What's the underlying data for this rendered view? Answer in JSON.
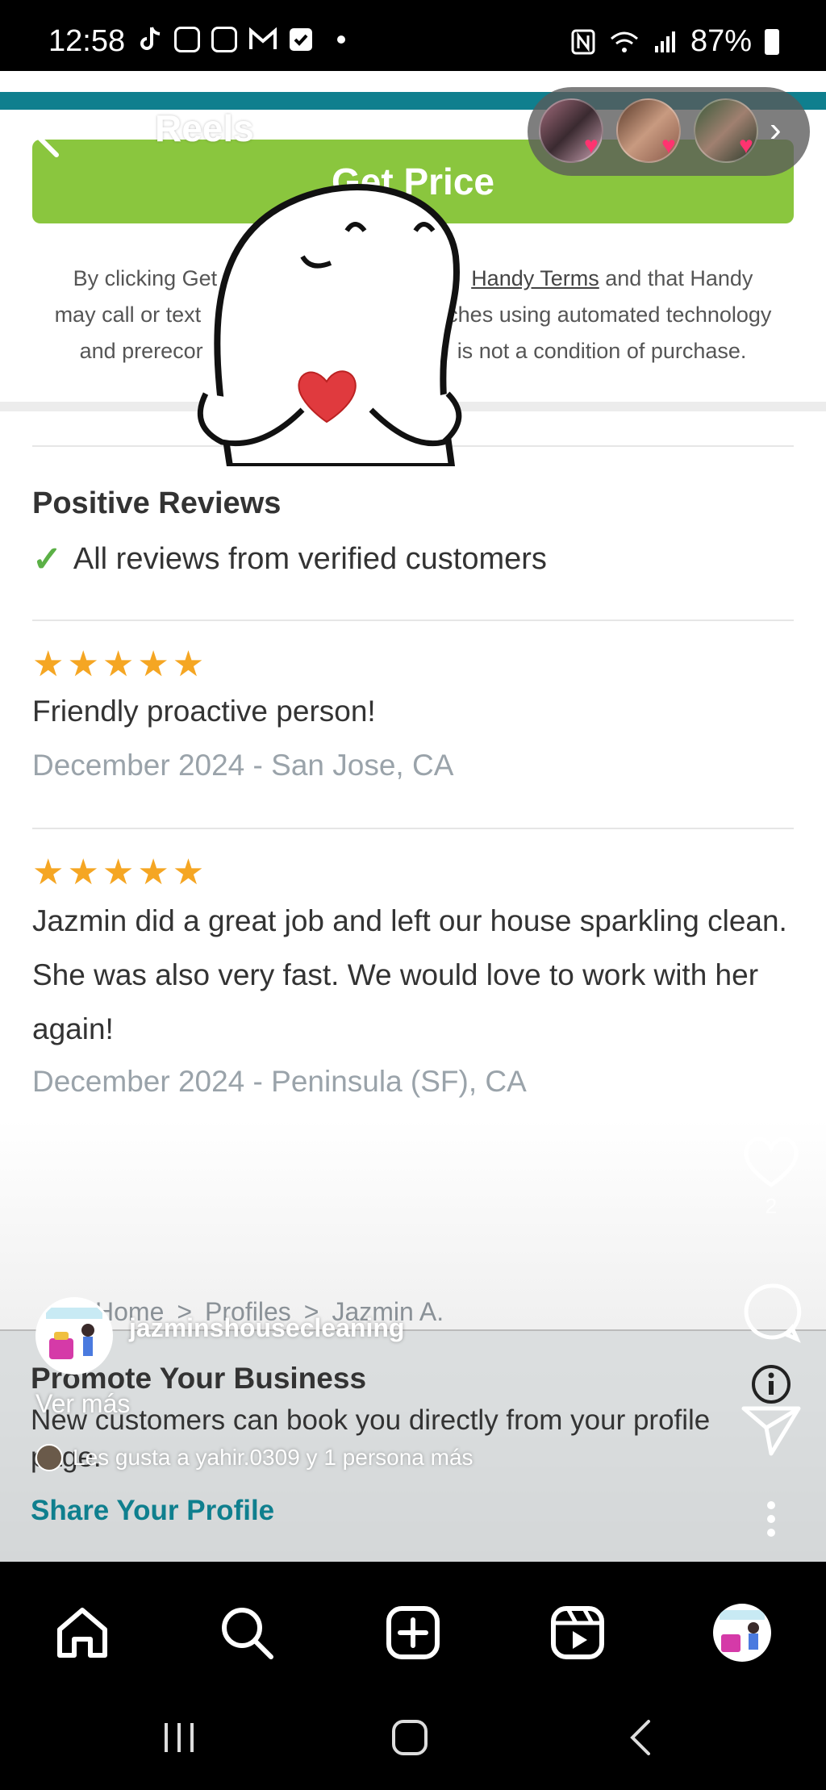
{
  "status_bar": {
    "time": "12:58",
    "battery": "87%"
  },
  "header": {
    "title": "Reels"
  },
  "page": {
    "cta_button": "Get Price",
    "disclaimer_pre": "By clicking Get",
    "disclaimer_link": "Handy Terms",
    "disclaimer_line1_end": "and that Handy",
    "disclaimer_line2_start": "may call or text",
    "disclaimer_line2_end": "ches using automated technology",
    "disclaimer_line3_start": "and prerecor",
    "disclaimer_line3_end": "is not a condition of purchase.",
    "reviews_heading": "Positive Reviews",
    "verified_text": "All reviews from verified customers",
    "reviews": [
      {
        "stars": "★★★★★",
        "text": "Friendly proactive person!",
        "meta": "December 2024 - San Jose, CA"
      },
      {
        "stars": "★★★★★",
        "text": "Jazmin did a great job and left our house sparkling clean. She was also very fast. We would love to work with her again!",
        "meta": "December 2024 - Peninsula (SF), CA"
      }
    ],
    "breadcrumb": {
      "home": "Home",
      "sep": ">",
      "profiles": "Profiles",
      "name": "Jazmin A."
    },
    "promo_title": "Promote Your Business",
    "promo_desc": "New customers can book you directly from your profile page.",
    "share_link": "Share Your Profile"
  },
  "reel": {
    "username": "jazminshousecleaning",
    "see_more": "Ver más",
    "likes_text": "Les gusta a yahir.0309 y 1 persona más",
    "like_count": "2"
  },
  "colors": {
    "cta_green": "#8ac63e",
    "teal": "#0f7f8e",
    "star": "#f5a623",
    "heart_red": "#e03a3e"
  }
}
